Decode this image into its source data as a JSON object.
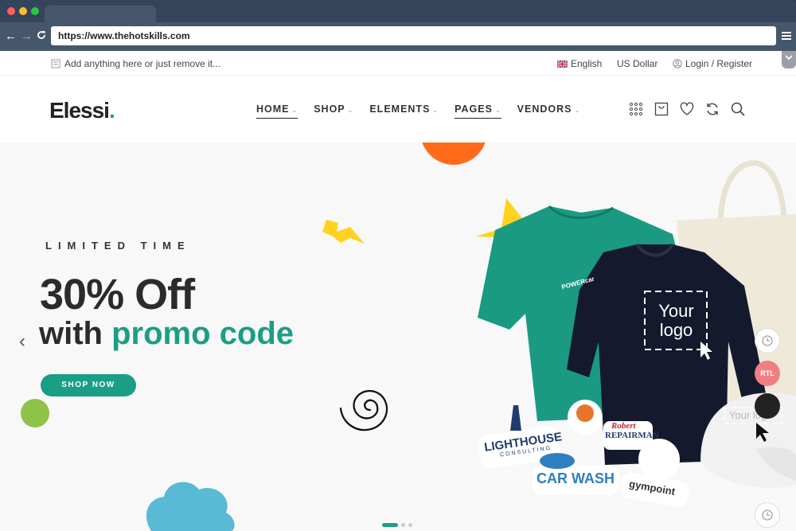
{
  "browser": {
    "url": "https://www.thehotskills.com",
    "traffic_lights": [
      "#ff5f57",
      "#febc2e",
      "#28c840"
    ],
    "nav": {
      "back": "←",
      "forward": "→",
      "reload": "C"
    }
  },
  "topbar": {
    "notice": "Add anything here or just remove it...",
    "language": "English",
    "currency": "US Dollar",
    "account": "Login / Register"
  },
  "header": {
    "logo_text": "Elessi",
    "logo_dot": ".",
    "nav": [
      {
        "label": "HOME",
        "active": true
      },
      {
        "label": "SHOP",
        "active": false
      },
      {
        "label": "ELEMENTS",
        "active": false
      },
      {
        "label": "PAGES",
        "active": true
      },
      {
        "label": "VENDORS",
        "active": false
      }
    ],
    "icons": [
      "grid-icon",
      "cart-icon",
      "heart-icon",
      "compare-icon",
      "search-icon"
    ]
  },
  "hero": {
    "eyebrow": "LIMITED TIME",
    "headline": "30% Off",
    "subline_prefix": "with",
    "subline_accent": "promo code",
    "cta": "SHOP NOW",
    "prev_arrow": "‹",
    "accent_color": "#1a9e86",
    "mockups": {
      "tshirt_brand": "POWERcar",
      "sweatshirt_text": [
        "Your",
        "logo"
      ],
      "cap_text": "Your logo",
      "stickers": [
        "LIGHTHOUSE",
        "CONSULTING",
        "Robert",
        "REPAIRMAN",
        "CAR WASH",
        "gympoint"
      ]
    },
    "side_buttons": {
      "rtl": "RTL"
    },
    "slides_total": 3,
    "active_slide": 1
  }
}
